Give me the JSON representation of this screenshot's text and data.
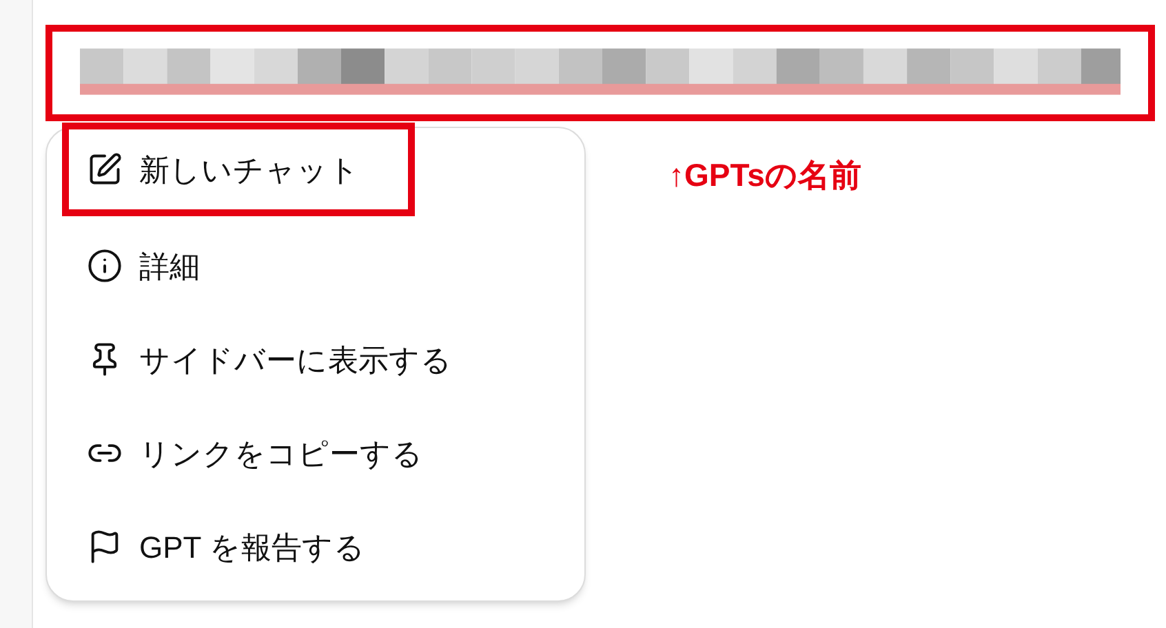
{
  "annotation": {
    "text": "↑GPTsの名前"
  },
  "menu": {
    "items": [
      {
        "label": "新しいチャット",
        "highlighted": true
      },
      {
        "label": "詳細",
        "highlighted": false
      },
      {
        "label": "サイドバーに表示する",
        "highlighted": false
      },
      {
        "label": "リンクをコピーする",
        "highlighted": false
      },
      {
        "label": "GPT を報告する",
        "highlighted": false
      }
    ]
  }
}
